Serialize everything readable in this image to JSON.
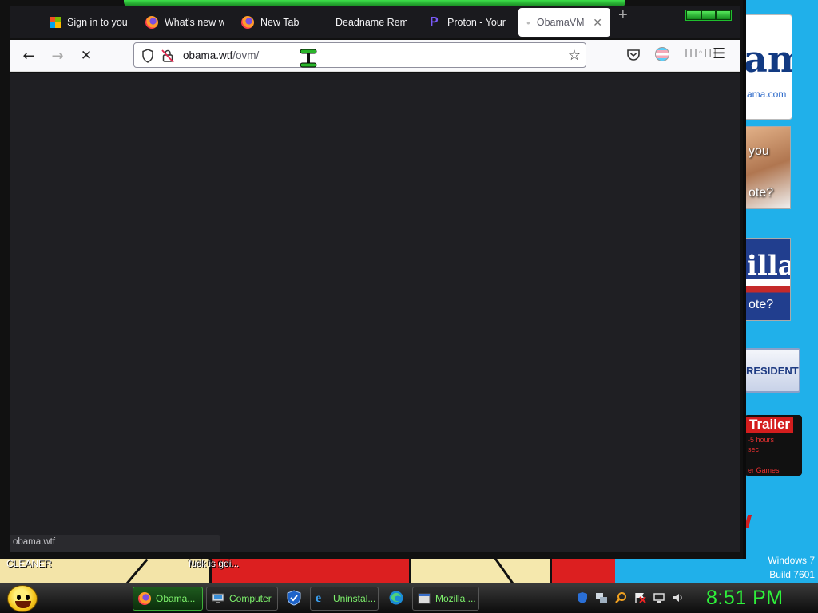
{
  "browser": {
    "tabs": [
      {
        "label": "Sign in to your account",
        "icon": "microsoft-logo-icon",
        "active": false
      },
      {
        "label": "What's new with Firefox",
        "icon": "firefox-icon",
        "active": false
      },
      {
        "label": "New Tab",
        "icon": "firefox-icon",
        "active": false
      },
      {
        "label": "Deadname Remover",
        "icon": "none",
        "active": false
      },
      {
        "label": "Proton - Your",
        "icon": "proton-icon",
        "active": false
      },
      {
        "label": "ObamaVM",
        "icon": "dot-icon",
        "active": true
      }
    ],
    "new_tab_symbol": "+",
    "url_domain": "obama.wtf",
    "url_path": "/ovm/",
    "status_url": "obama.wtf",
    "nav": {
      "back": "←",
      "forward": "→",
      "stop": "✕"
    },
    "bookmark_star": "☆",
    "menu": "☰",
    "ext2": "|||◦|||"
  },
  "desktop": {
    "ad_logo_big": "am",
    "ad_logo_small": "ama.com",
    "ad_face_line1": "you",
    "ad_face_line2": "ote?",
    "ad_flag_big": "illa",
    "ad_flag_line2": "ote?",
    "ad_president": "RESIDENT",
    "ad_trailer_head": "Trailer",
    "ad_trailer_l1": "-5 hours",
    "ad_trailer_l2": "sec",
    "ad_trailer_l3": "er Games",
    "cleaner_label": "CLEANER",
    "cartoon_caption": "fuck is goi...",
    "watermark_line1": "Windows 7",
    "watermark_line2": "Build 7601"
  },
  "taskbar": {
    "items": [
      {
        "label": "Obama...",
        "icon": "firefox-icon",
        "active": true
      },
      {
        "label": "Computer",
        "icon": "computer-icon",
        "active": false
      },
      {
        "label": "",
        "icon": "defender-shield-icon",
        "active": false
      },
      {
        "label": "Uninstal...",
        "icon": "internet-explorer-icon",
        "active": false
      },
      {
        "label": "",
        "icon": "edge-icon",
        "active": false
      },
      {
        "label": "Mozilla ...",
        "icon": "window-icon",
        "active": false
      }
    ],
    "clock": "8:51 PM"
  },
  "colors": {
    "desktop_bg": "#20b0ea",
    "browser_content_bg": "#1f1f23",
    "clock_green": "#2ef03a",
    "taskbar_text_green": "#7ef36c"
  }
}
